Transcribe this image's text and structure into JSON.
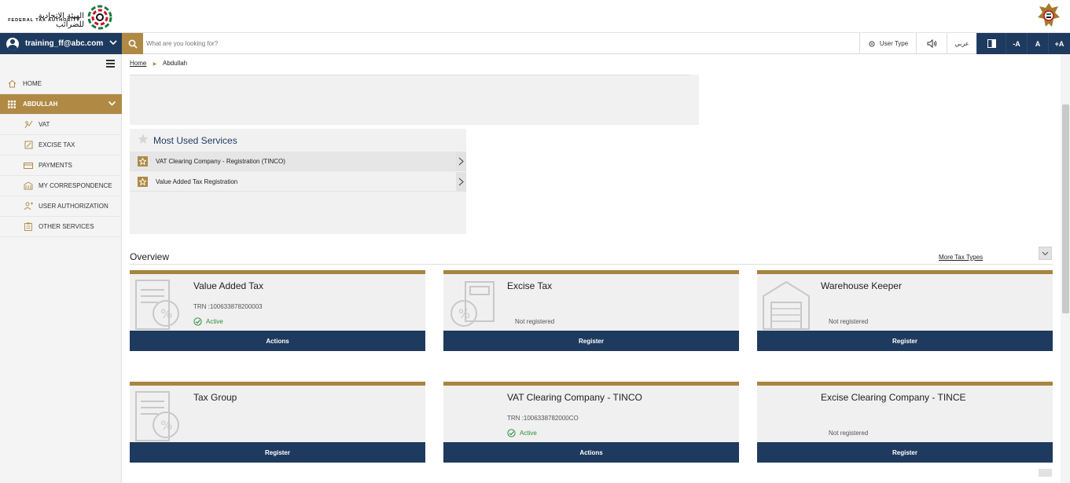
{
  "header": {
    "logo_arabic": "الهيئة الاتحادية للضرائب",
    "logo_english": "FEDERAL TAX AUTHORITY"
  },
  "nav": {
    "user": "training_ff@abc.com",
    "search_placeholder": "What are you looking for?",
    "user_type": "User Type",
    "language": "عربي",
    "font_decrease": "-A",
    "font_normal": "A",
    "font_increase": "+A"
  },
  "sidebar": {
    "items": [
      {
        "label": "HOME",
        "icon": "home-icon"
      },
      {
        "label": "ABDULLAH",
        "icon": "grid-icon"
      },
      {
        "label": "VAT",
        "icon": "vat-icon"
      },
      {
        "label": "EXCISE TAX",
        "icon": "excise-icon"
      },
      {
        "label": "PAYMENTS",
        "icon": "payments-icon"
      },
      {
        "label": "MY CORRESPONDENCE",
        "icon": "correspondence-icon"
      },
      {
        "label": "USER AUTHORIZATION",
        "icon": "user-authorization-icon"
      },
      {
        "label": "OTHER SERVICES",
        "icon": "clipboard-icon"
      }
    ]
  },
  "breadcrumb": {
    "home": "Home",
    "current": "Abdullah"
  },
  "most_used": {
    "title": "Most Used Services",
    "items": [
      "VAT Clearing Company - Registration (TINCO)",
      "Value Added Tax Registration"
    ]
  },
  "overview": {
    "title": "Overview",
    "more_link": "More Tax Types",
    "cards": [
      {
        "title": "Value Added Tax",
        "trn": "TRN :100633878200003",
        "status": "Active",
        "button": "Actions"
      },
      {
        "title": "Excise Tax",
        "status": "Not registered",
        "button": "Register"
      },
      {
        "title": "Warehouse Keeper",
        "status": "Not registered",
        "button": "Register"
      },
      {
        "title": "Tax Group",
        "button": "Register"
      },
      {
        "title": "VAT Clearing Company - TINCO",
        "trn": "TRN :1006338782000CO",
        "status": "Active",
        "button": "Actions"
      },
      {
        "title": "Excise Clearing Company - TINCE",
        "status": "Not registered",
        "button": "Register"
      }
    ]
  },
  "colors": {
    "navy": "#1e3a5f",
    "gold": "#b08a45",
    "active_green": "#2e8b3a"
  }
}
